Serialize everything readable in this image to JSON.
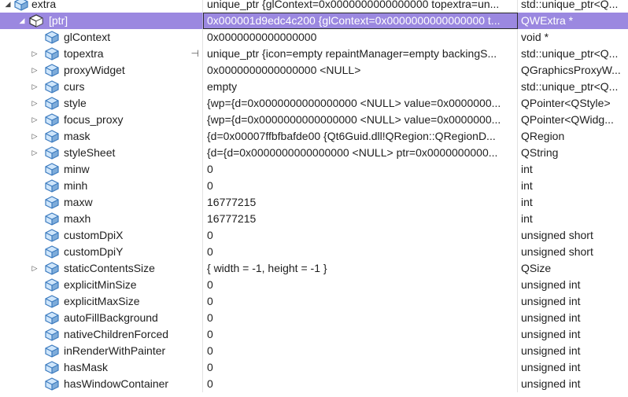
{
  "rows": [
    {
      "name": "extra",
      "value": "unique_ptr {glContext=0x0000000000000000 topextra=un...",
      "type": "std::unique_ptr<Q...",
      "depth": 0,
      "expander": "open",
      "selected": false
    },
    {
      "name": "[ptr]",
      "value": "0x000001d9edc4c200 {glContext=0x0000000000000000 t...",
      "type": "QWExtra *",
      "depth": 1,
      "expander": "open",
      "selected": true
    },
    {
      "name": "glContext",
      "value": "0x0000000000000000",
      "type": "void *",
      "depth": 2,
      "expander": "none",
      "selected": false
    },
    {
      "name": "topextra",
      "value": "unique_ptr {icon=empty repaintManager=empty backingS...",
      "type": "std::unique_ptr<Q...",
      "depth": 2,
      "expander": "closed",
      "selected": false,
      "pin": true
    },
    {
      "name": "proxyWidget",
      "value": "0x0000000000000000 <NULL>",
      "type": "QGraphicsProxyW...",
      "depth": 2,
      "expander": "closed",
      "selected": false
    },
    {
      "name": "curs",
      "value": "empty",
      "type": "std::unique_ptr<Q...",
      "depth": 2,
      "expander": "closed",
      "selected": false
    },
    {
      "name": "style",
      "value": "{wp={d=0x0000000000000000 <NULL> value=0x0000000...",
      "type": "QPointer<QStyle>",
      "depth": 2,
      "expander": "closed",
      "selected": false
    },
    {
      "name": "focus_proxy",
      "value": "{wp={d=0x0000000000000000 <NULL> value=0x0000000...",
      "type": "QPointer<QWidg...",
      "depth": 2,
      "expander": "closed",
      "selected": false
    },
    {
      "name": "mask",
      "value": "{d=0x00007ffbfbafde00 {Qt6Guid.dll!QRegion::QRegionD...",
      "type": "QRegion",
      "depth": 2,
      "expander": "closed",
      "selected": false
    },
    {
      "name": "styleSheet",
      "value": "{d={d=0x0000000000000000 <NULL> ptr=0x0000000000...",
      "type": "QString",
      "depth": 2,
      "expander": "closed",
      "selected": false
    },
    {
      "name": "minw",
      "value": "0",
      "type": "int",
      "depth": 2,
      "expander": "none",
      "selected": false
    },
    {
      "name": "minh",
      "value": "0",
      "type": "int",
      "depth": 2,
      "expander": "none",
      "selected": false
    },
    {
      "name": "maxw",
      "value": "16777215",
      "type": "int",
      "depth": 2,
      "expander": "none",
      "selected": false
    },
    {
      "name": "maxh",
      "value": "16777215",
      "type": "int",
      "depth": 2,
      "expander": "none",
      "selected": false
    },
    {
      "name": "customDpiX",
      "value": "0",
      "type": "unsigned short",
      "depth": 2,
      "expander": "none",
      "selected": false
    },
    {
      "name": "customDpiY",
      "value": "0",
      "type": "unsigned short",
      "depth": 2,
      "expander": "none",
      "selected": false
    },
    {
      "name": "staticContentsSize",
      "value": "{ width = -1, height = -1 }",
      "type": "QSize",
      "depth": 2,
      "expander": "closed",
      "selected": false
    },
    {
      "name": "explicitMinSize",
      "value": "0",
      "type": "unsigned int",
      "depth": 2,
      "expander": "none",
      "selected": false
    },
    {
      "name": "explicitMaxSize",
      "value": "0",
      "type": "unsigned int",
      "depth": 2,
      "expander": "none",
      "selected": false
    },
    {
      "name": "autoFillBackground",
      "value": "0",
      "type": "unsigned int",
      "depth": 2,
      "expander": "none",
      "selected": false
    },
    {
      "name": "nativeChildrenForced",
      "value": "0",
      "type": "unsigned int",
      "depth": 2,
      "expander": "none",
      "selected": false
    },
    {
      "name": "inRenderWithPainter",
      "value": "0",
      "type": "unsigned int",
      "depth": 2,
      "expander": "none",
      "selected": false
    },
    {
      "name": "hasMask",
      "value": "0",
      "type": "unsigned int",
      "depth": 2,
      "expander": "none",
      "selected": false
    },
    {
      "name": "hasWindowContainer",
      "value": "0",
      "type": "unsigned int",
      "depth": 2,
      "expander": "none",
      "selected": false
    }
  ],
  "icons": {
    "field": "field-cube-icon",
    "pin": "pin-icon",
    "expand_closed": "chevron-right-icon",
    "expand_open": "chevron-down-icon"
  },
  "colors": {
    "selection": "#9b88e0",
    "icon_blue": "#3c7bbf",
    "icon_light": "#cfe6fb"
  }
}
